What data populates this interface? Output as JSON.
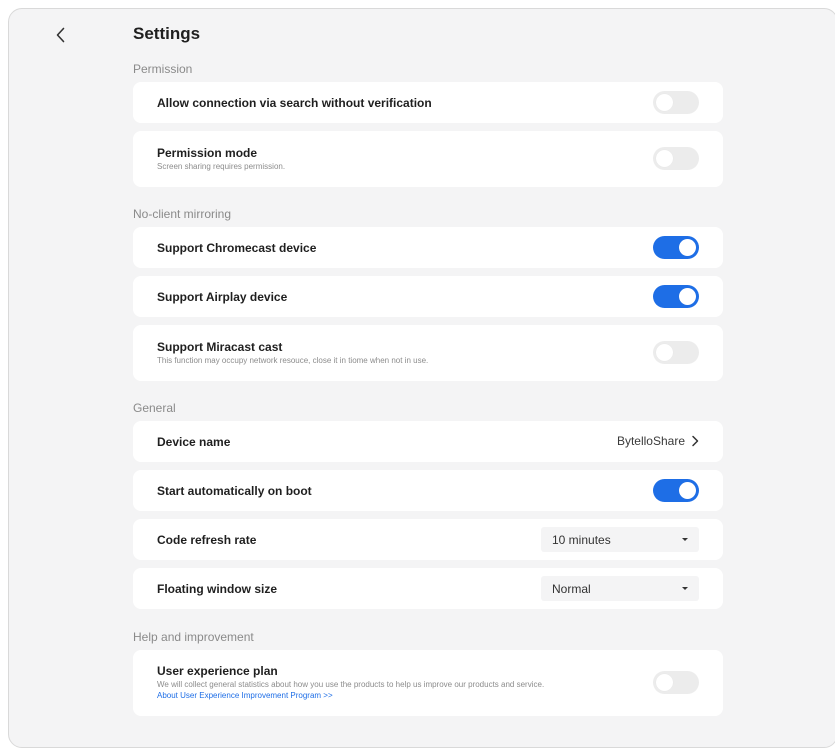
{
  "header": {
    "title": "Settings",
    "back_icon": "chevron-left-icon"
  },
  "permission": {
    "label": "Permission",
    "search_connection": {
      "title": "Allow connection via search without verification",
      "enabled": false
    },
    "permission_mode": {
      "title": "Permission mode",
      "description": "Screen sharing requires permission.",
      "enabled": false
    }
  },
  "mirroring": {
    "label": "No-client mirroring",
    "chromecast": {
      "title": "Support Chromecast device",
      "enabled": true
    },
    "airplay": {
      "title": "Support Airplay device",
      "enabled": true
    },
    "miracast": {
      "title": "Support Miracast cast",
      "description": "This function may occupy network resouce, close it in tiome when not in use.",
      "enabled": false
    }
  },
  "general": {
    "label": "General",
    "device_name": {
      "title": "Device name",
      "value": "BytelloShare"
    },
    "auto_start": {
      "title": "Start automatically on boot",
      "enabled": true
    },
    "code_refresh": {
      "title": "Code refresh rate",
      "value": "10 minutes"
    },
    "floating_window": {
      "title": "Floating window size",
      "value": "Normal"
    }
  },
  "help": {
    "label": "Help and improvement",
    "ux_plan": {
      "title": "User experience plan",
      "description": "We will collect general statistics about how you use the products to help us improve our products and service.",
      "link": "About User Experience Improvement Program >>",
      "enabled": false
    }
  },
  "colors": {
    "accent": "#1e6ee6",
    "background": "#f4f4f5",
    "card": "#ffffff",
    "toggle_off": "#ececec"
  }
}
